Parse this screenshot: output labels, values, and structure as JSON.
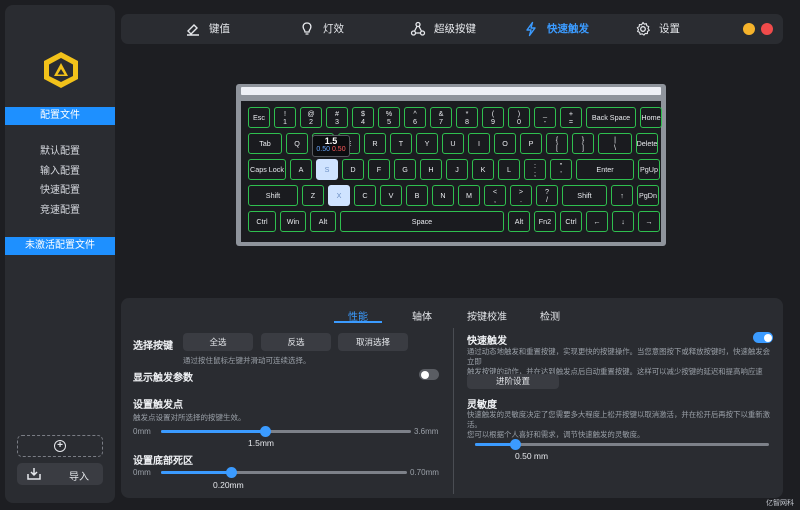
{
  "sidebar": {
    "profiles_header": "配置文件",
    "profiles": [
      "默认配置",
      "输入配置",
      "快速配置",
      "竞速配置"
    ],
    "inactive_header": "未激活配置文件",
    "import_label": "导入"
  },
  "nav": {
    "items": [
      {
        "label": "键值",
        "icon": "keycap-icon"
      },
      {
        "label": "灯效",
        "icon": "bulb-icon"
      },
      {
        "label": "超级按键",
        "icon": "nodes-icon"
      },
      {
        "label": "快速触发",
        "icon": "lightning-icon"
      },
      {
        "label": "设置",
        "icon": "gear-icon"
      }
    ],
    "active": "快速触发",
    "window_controls": {
      "minimize_color": "#f5b32b",
      "close_color": "#f04b4b"
    }
  },
  "keyboard": {
    "rows": [
      [
        "Esc",
        "!\n1",
        "@\n2",
        "#\n3",
        "$\n4",
        "%\n5",
        "^\n6",
        "&\n7",
        "*\n8",
        "(\n9",
        ")\n0",
        "_\n-",
        "+\n=",
        "Back Space",
        "Home"
      ],
      [
        "Tab",
        "Q",
        "W",
        "E",
        "R",
        "T",
        "Y",
        "U",
        "I",
        "O",
        "P",
        "{\n[",
        "}\n]",
        "|\n\\",
        "Delete"
      ],
      [
        "Caps Lock",
        "A",
        "S",
        "D",
        "F",
        "G",
        "H",
        "J",
        "K",
        "L",
        ":\n;",
        "\"\n'",
        "Enter",
        "PgUp"
      ],
      [
        "Shift",
        "Z",
        "X",
        "C",
        "V",
        "B",
        "N",
        "M",
        "<\n,",
        ">\n.",
        "?\n/",
        "Shift",
        "↑",
        "PgDn"
      ],
      [
        "Ctrl",
        "Win",
        "Alt",
        "Space",
        "Alt",
        "Fn2",
        "Ctrl",
        "←",
        "↓",
        "→"
      ]
    ],
    "selected_keys": [
      "S",
      "X"
    ],
    "popup": {
      "travel": "1.5",
      "press": "0.50",
      "release": "0.50"
    },
    "accent_colors": {
      "key_border": "#2fbf4f",
      "selected": "#cfe3ff"
    }
  },
  "panel": {
    "tabs": [
      "性能",
      "轴体",
      "按键校准",
      "检测"
    ],
    "active_tab": "性能",
    "select_keys": {
      "label": "选择按键",
      "buttons": [
        "全选",
        "反选",
        "取消选择"
      ],
      "hint": "通过按住鼠标左键并滑动可连续选择。"
    },
    "show_params": {
      "label": "显示触发参数",
      "on": false
    },
    "actuation": {
      "label": "设置触发点",
      "hint": "触发点设置对所选择的按键生效。",
      "min": "0mm",
      "max": "3.6mm",
      "value": "1.5mm",
      "fraction": 0.4167
    },
    "deadzone": {
      "label": "设置底部死区",
      "min": "0mm",
      "max": "0.70mm",
      "value": "0.20mm",
      "fraction": 0.2857
    },
    "rapid_trigger": {
      "label": "快速触发",
      "on": true,
      "desc_1": "通过动态地触发和重置按键，实现更快的按键操作。当您意图按下或释放按键时，快速触发会立即",
      "desc_2": "触发按键的动作，并在达到触发点后自动重置按键。这样可以减少按键的延迟和提高响应速度。",
      "advanced_button": "进阶设置"
    },
    "sensitivity": {
      "label": "灵敏度",
      "desc_1": "快速触发的灵敏度决定了您需要多大程度上松开按键以取消激活，并在松开后再按下以重新激活。",
      "desc_2": "您可以根据个人喜好和需求，调节快速触发的灵敏度。",
      "value": "0.50 mm",
      "fraction": 0.1389
    }
  },
  "watermark": "亿智网科"
}
